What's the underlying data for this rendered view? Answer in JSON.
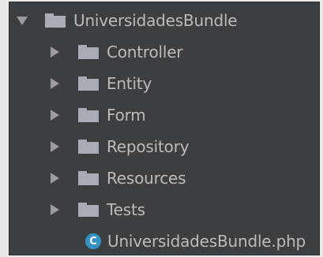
{
  "tree": {
    "root": {
      "label": "UniversidadesBundle",
      "expanded": true,
      "icon": "folder-icon"
    },
    "children": [
      {
        "label": "Controller",
        "type": "folder",
        "expanded": false,
        "icon": "folder-icon"
      },
      {
        "label": "Entity",
        "type": "folder",
        "expanded": false,
        "icon": "folder-icon"
      },
      {
        "label": "Form",
        "type": "folder",
        "expanded": false,
        "icon": "folder-icon"
      },
      {
        "label": "Repository",
        "type": "folder",
        "expanded": false,
        "icon": "folder-icon"
      },
      {
        "label": "Resources",
        "type": "folder",
        "expanded": false,
        "icon": "folder-icon"
      },
      {
        "label": "Tests",
        "type": "folder",
        "expanded": false,
        "icon": "folder-icon"
      },
      {
        "label": "UniversidadesBundle.php",
        "type": "php-class",
        "icon": "php-class-icon",
        "icon_letter": "C"
      }
    ]
  },
  "colors": {
    "panel_background": "#3c3f41",
    "text": "#bbbbbb",
    "folder_icon": "#a7adb3",
    "php_class_icon": "#3592c4"
  }
}
